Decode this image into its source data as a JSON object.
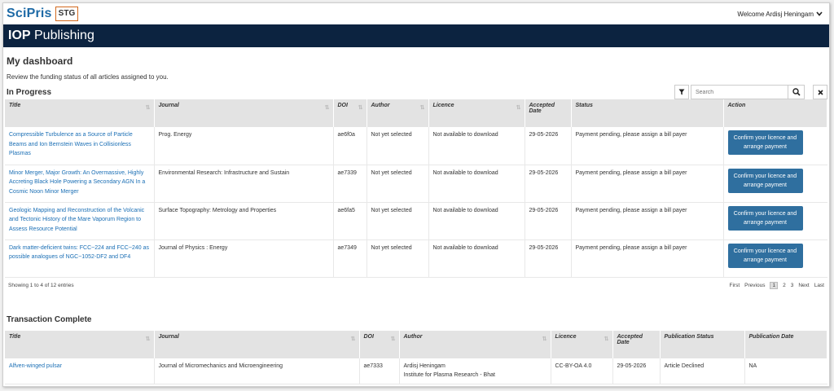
{
  "app": {
    "logo": "SciPris",
    "env_badge": "STG",
    "welcome": "Welcome Ardisj Heningam",
    "brand_bold": "IOP",
    "brand_rest": " Publishing"
  },
  "dashboard": {
    "title": "My dashboard",
    "subtitle": "Review the funding status of all articles assigned to you."
  },
  "in_progress": {
    "title": "In Progress",
    "search_placeholder": "Search",
    "columns": [
      "Title",
      "Journal",
      "DOI",
      "Author",
      "Licence",
      "Accepted Date",
      "Status",
      "Action"
    ],
    "rows": [
      {
        "title": "Compressible Turbulence as a Source of Particle Beams and Ion Bernstein Waves in Collisionless Plasmas",
        "journal": "Prog. Energy",
        "doi": "ae6f0a",
        "author": "Not yet selected",
        "licence": "Not available to download",
        "accepted": "29-05-2026",
        "status": "Payment pending, please assign a bill payer",
        "action": "Confirm your licence and arrange payment"
      },
      {
        "title": "Minor Merger, Major Growth: An Overmassive, Highly Accreting Black Hole Powering a Secondary AGN In a Cosmic Noon Minor Merger",
        "journal": "Environmental Research: Infrastructure and Sustain",
        "doi": "ae7339",
        "author": "Not yet selected",
        "licence": "Not available to download",
        "accepted": "29-05-2026",
        "status": "Payment pending, please assign a bill payer",
        "action": "Confirm your licence and arrange payment"
      },
      {
        "title": "Geologic Mapping and Reconstruction of the Volcanic and Tectonic History of the Mare Vaporum Region to Assess Resource Potential",
        "journal": "Surface Topography: Metrology and Properties",
        "doi": "ae6fa5",
        "author": "Not yet selected",
        "licence": "Not available to download",
        "accepted": "29-05-2026",
        "status": "Payment pending, please assign a bill payer",
        "action": "Confirm your licence and arrange payment"
      },
      {
        "title": "Dark matter-deficient twins: FCC~224 and FCC~240 as possible analogues of NGC~1052-DF2 and DF4",
        "journal": "Journal of Physics : Energy",
        "doi": "ae7349",
        "author": "Not yet selected",
        "licence": "Not available to download",
        "accepted": "29-05-2026",
        "status": "Payment pending, please assign a bill payer",
        "action": "Confirm your licence and arrange payment"
      }
    ],
    "entries_info": "Showing 1 to 4 of 12 entries",
    "pager": {
      "first": "First",
      "previous": "Previous",
      "pages": [
        "1",
        "2",
        "3"
      ],
      "next": "Next",
      "last": "Last"
    }
  },
  "transaction_complete": {
    "title": "Transaction Complete",
    "columns": [
      "Title",
      "Journal",
      "DOI",
      "Author",
      "Licence",
      "Accepted Date",
      "Publication Status",
      "Publication Date"
    ],
    "rows": [
      {
        "title": "Alfven-winged pulsar",
        "journal": "Journal of Micromechanics and Microengineering",
        "doi": "ae7333",
        "author_name": "Ardisj Heningam",
        "author_inst": "Institute for Plasma Research - Bhat",
        "licence": "CC-BY-OA 4.0",
        "accepted": "29-05-2026",
        "pub_status": "Article Declined",
        "pub_date": "NA"
      }
    ]
  }
}
